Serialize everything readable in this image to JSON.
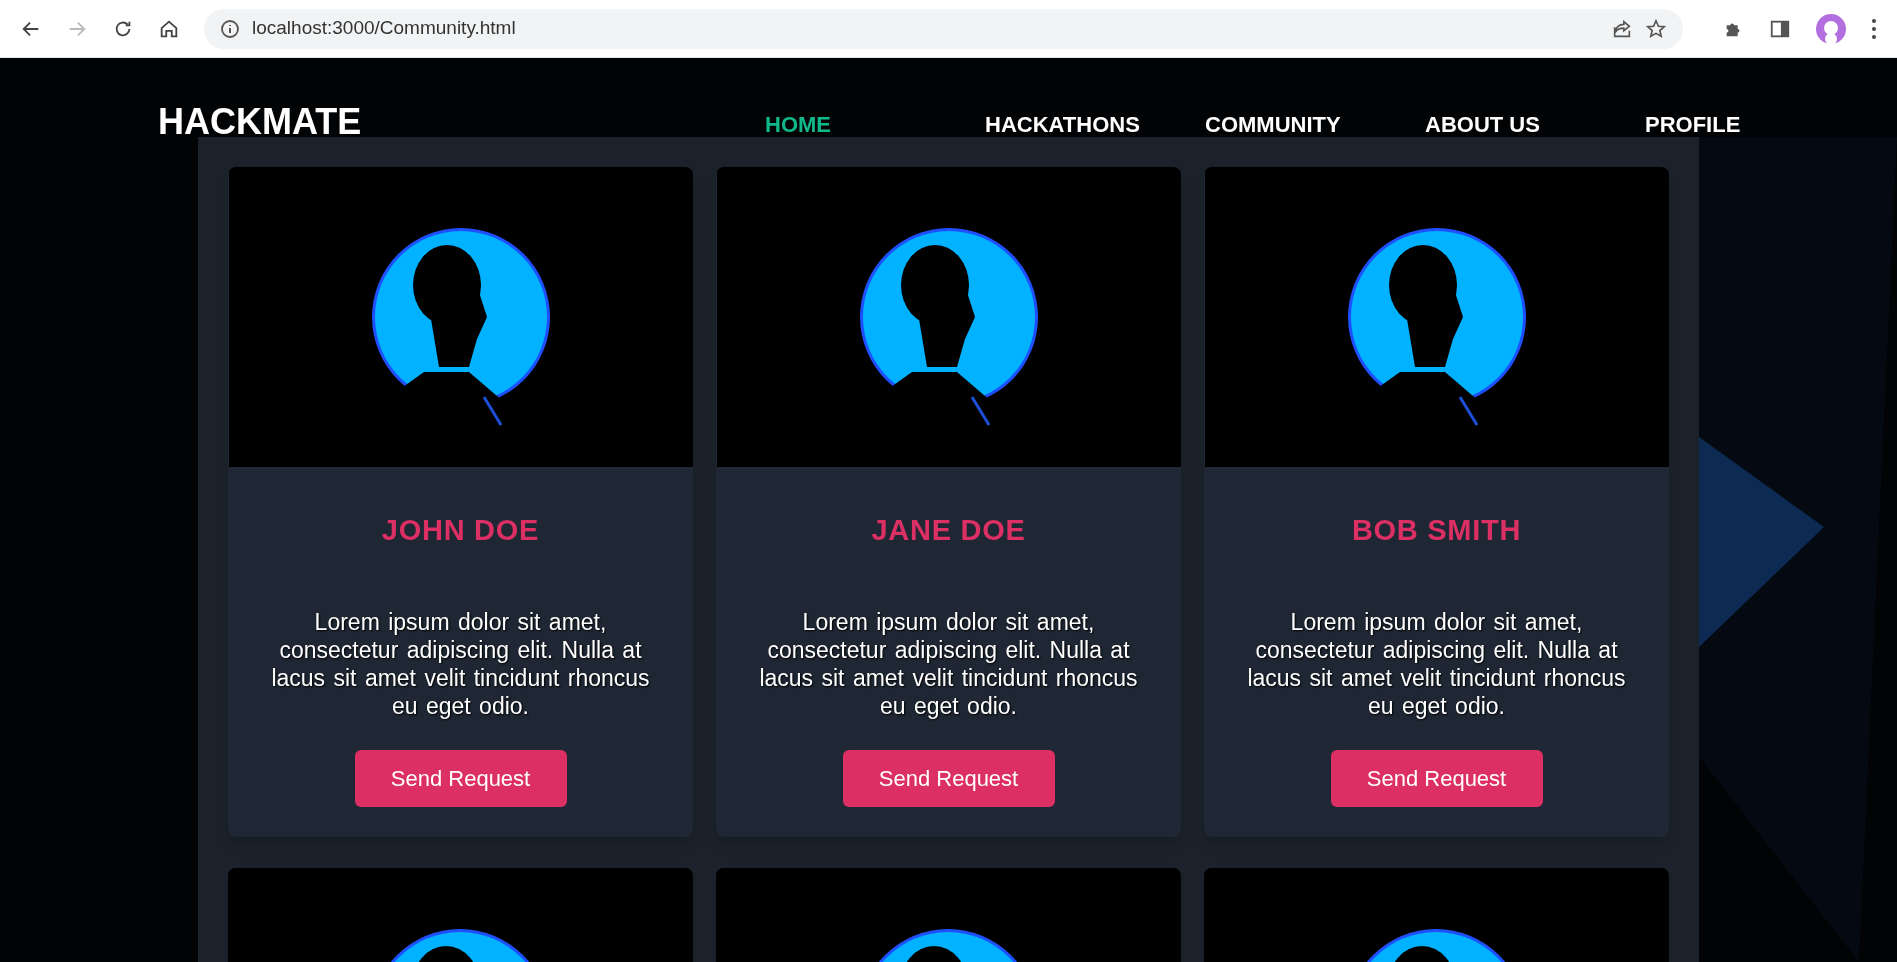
{
  "browser": {
    "url": "localhost:3000/Community.html",
    "forward_disabled": true
  },
  "site": {
    "logo": "HACKMATE",
    "nav": [
      {
        "label": "HOME",
        "selected": true
      },
      {
        "label": "HACKATHONS",
        "selected": false
      },
      {
        "label": "COMMUNITY",
        "selected": false
      },
      {
        "label": "ABOUT US",
        "selected": false
      },
      {
        "label": "PROFILE",
        "selected": false
      }
    ]
  },
  "cards": [
    {
      "kind": "profile",
      "name": "JOHN DOE",
      "bio": "Lorem ipsum dolor sit amet, consectetur adipiscing elit. Nulla at lacus sit amet velit tincidunt rhoncus eu eget odio.",
      "button": "Send Request"
    },
    {
      "kind": "profile",
      "name": "JANE DOE",
      "bio": "Lorem ipsum dolor sit amet, consectetur adipiscing elit. Nulla at lacus sit amet velit tincidunt rhoncus eu eget odio.",
      "button": "Send Request"
    },
    {
      "kind": "profile",
      "name": "BOB SMITH",
      "bio": "Lorem ipsum dolor sit amet, consectetur adipiscing elit. Nulla at lacus sit amet velit tincidunt rhoncus eu eget odio.",
      "button": "Send Request"
    },
    {
      "kind": "picture"
    },
    {
      "kind": "picture"
    },
    {
      "kind": "picture"
    }
  ]
}
